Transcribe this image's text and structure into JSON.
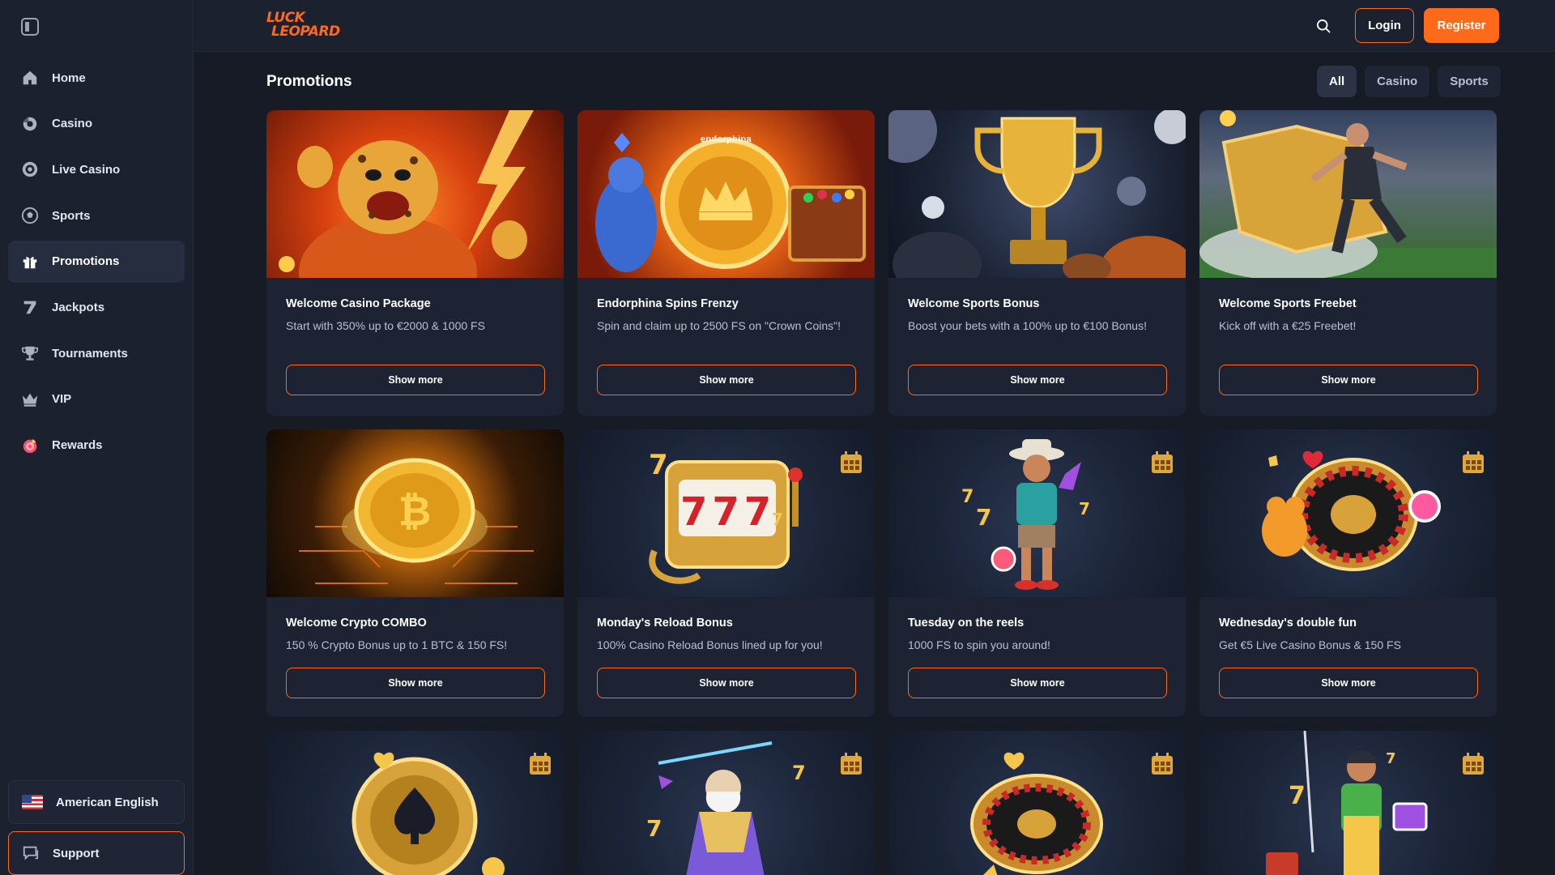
{
  "sidebar": {
    "items": [
      {
        "label": "Home",
        "icon": "home-icon",
        "active": false
      },
      {
        "label": "Casino",
        "icon": "casino-chip-icon",
        "active": false
      },
      {
        "label": "Live Casino",
        "icon": "live-casino-icon",
        "active": false
      },
      {
        "label": "Sports",
        "icon": "soccer-ball-icon",
        "active": false
      },
      {
        "label": "Promotions",
        "icon": "gift-icon",
        "active": true
      },
      {
        "label": "Jackpots",
        "icon": "seven-icon",
        "active": false
      },
      {
        "label": "Tournaments",
        "icon": "trophy-icon",
        "active": false
      },
      {
        "label": "VIP",
        "icon": "crown-icon",
        "active": false
      },
      {
        "label": "Rewards",
        "icon": "rewards-icon",
        "active": false
      }
    ],
    "language": "American English",
    "support": "Support"
  },
  "header": {
    "logo_line1": "Luck",
    "logo_line2": "Leopard",
    "login": "Login",
    "register": "Register"
  },
  "main": {
    "title": "Promotions",
    "filters": [
      "All",
      "Casino",
      "Sports"
    ],
    "active_filter": "All",
    "cards": [
      {
        "title": "Welcome Casino Package",
        "desc": "Start with 350% up to €2000 & 1000 FS",
        "button": "Show more"
      },
      {
        "title": "Endorphina Spins Frenzy",
        "desc": "Spin and claim up to 2500 FS on \"Crown Coins\"!",
        "button": "Show more",
        "brand": "endorphina"
      },
      {
        "title": "Welcome Sports Bonus",
        "desc": "Boost your bets with a 100% up to €100 Bonus!",
        "button": "Show more"
      },
      {
        "title": "Welcome Sports Freebet",
        "desc": "Kick off with a €25 Freebet!",
        "button": "Show more"
      },
      {
        "title": "Welcome Crypto COMBO",
        "desc": "150 % Crypto Bonus up to 1 BTC & 150 FS!",
        "button": "Show more"
      },
      {
        "title": "Monday's Reload Bonus",
        "desc": "100% Casino Reload Bonus lined up for you!",
        "button": "Show more",
        "reels": "777"
      },
      {
        "title": "Tuesday on the reels",
        "desc": "1000 FS to spin you around!",
        "button": "Show more"
      },
      {
        "title": "Wednesday's double fun",
        "desc": "Get €5 Live Casino Bonus & 150 FS",
        "button": "Show more"
      }
    ]
  },
  "colors": {
    "accent": "#ff6a1a",
    "background": "#161b26",
    "panel": "#1c2130",
    "card": "#1d2332"
  }
}
